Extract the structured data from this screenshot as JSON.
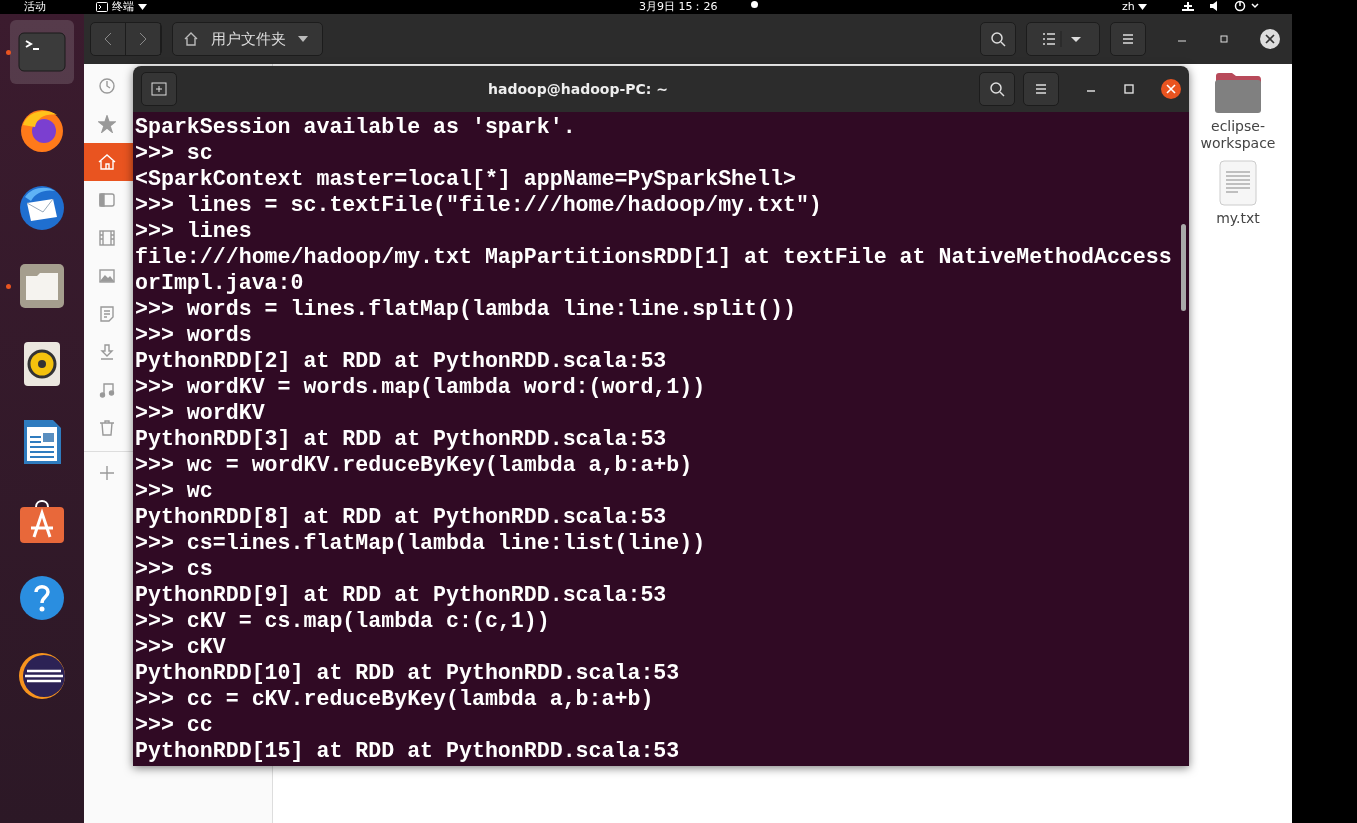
{
  "top_bar": {
    "activities": "活动",
    "app_menu": "终端",
    "clock": "3月9日 15：26",
    "input_method": "zh"
  },
  "dock": [
    {
      "kind": "terminal",
      "running": true,
      "selected": true
    },
    {
      "kind": "firefox",
      "running": false,
      "selected": false
    },
    {
      "kind": "mail",
      "running": false,
      "selected": false
    },
    {
      "kind": "files",
      "running": true,
      "selected": false
    },
    {
      "kind": "speaker",
      "running": false,
      "selected": false
    },
    {
      "kind": "writer",
      "running": false,
      "selected": false
    },
    {
      "kind": "store",
      "running": false,
      "selected": false
    },
    {
      "kind": "help",
      "running": false,
      "selected": false
    },
    {
      "kind": "eclipse",
      "running": false,
      "selected": false
    }
  ],
  "file_manager": {
    "location": "用户文件夹",
    "sidebar": [
      {
        "kind": "recent",
        "selected": false
      },
      {
        "kind": "starred",
        "selected": false
      },
      {
        "kind": "home",
        "selected": true
      },
      {
        "kind": "desktop",
        "selected": false
      },
      {
        "kind": "videos",
        "selected": false
      },
      {
        "kind": "pictures",
        "selected": false
      },
      {
        "kind": "documents",
        "selected": false
      },
      {
        "kind": "downloads",
        "selected": false
      },
      {
        "kind": "music",
        "selected": false
      },
      {
        "kind": "trash",
        "selected": false
      },
      {
        "kind": "other",
        "selected": false
      }
    ],
    "files": [
      {
        "kind": "folder",
        "name": "eclipse-workspace"
      },
      {
        "kind": "text",
        "name": "my.txt"
      }
    ]
  },
  "terminal": {
    "title": "hadoop@hadoop-PC: ~",
    "lines": [
      "SparkSession available as 'spark'.",
      ">>> sc",
      "<SparkContext master=local[*] appName=PySparkShell>",
      ">>> lines = sc.textFile(\"file:///home/hadoop/my.txt\")",
      ">>> lines",
      "file:///home/hadoop/my.txt MapPartitionsRDD[1] at textFile at NativeMethodAccess",
      "orImpl.java:0",
      ">>> words = lines.flatMap(lambda line:line.split())",
      ">>> words",
      "PythonRDD[2] at RDD at PythonRDD.scala:53",
      ">>> wordKV = words.map(lambda word:(word,1))",
      ">>> wordKV",
      "PythonRDD[3] at RDD at PythonRDD.scala:53",
      ">>> wc = wordKV.reduceByKey(lambda a,b:a+b)",
      ">>> wc",
      "PythonRDD[8] at RDD at PythonRDD.scala:53",
      ">>> cs=lines.flatMap(lambda line:list(line))",
      ">>> cs",
      "PythonRDD[9] at RDD at PythonRDD.scala:53",
      ">>> cKV = cs.map(lambda c:(c,1))",
      ">>> cKV",
      "PythonRDD[10] at RDD at PythonRDD.scala:53",
      ">>> cc = cKV.reduceByKey(lambda a,b:a+b)",
      ">>> cc",
      "PythonRDD[15] at RDD at PythonRDD.scala:53"
    ]
  }
}
